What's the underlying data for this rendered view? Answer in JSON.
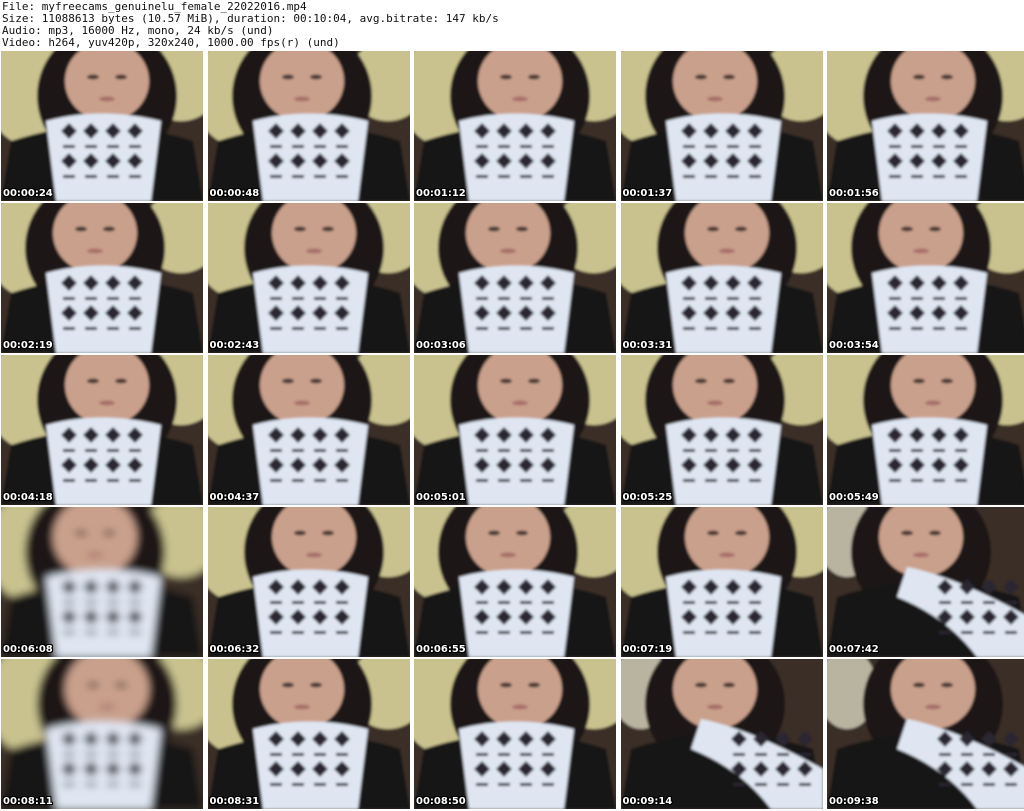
{
  "header": {
    "file": "File: myfreecams_genuinelu_female_22022016.mp4",
    "size": "Size: 11088613 bytes (10.57 MiB), duration: 00:10:04, avg.bitrate: 147 kb/s",
    "audio": "Audio: mp3, 16000 Hz, mono, 24 kb/s (und)",
    "video": "Video: h264, yuv420p, 320x240, 1000.00 fps(r) (und)"
  },
  "thumbnails": [
    {
      "timestamp": "00:00:24",
      "scene": "pillow"
    },
    {
      "timestamp": "00:00:48",
      "scene": "pillow"
    },
    {
      "timestamp": "00:01:12",
      "scene": "pillow"
    },
    {
      "timestamp": "00:01:37",
      "scene": "pillow"
    },
    {
      "timestamp": "00:01:56",
      "scene": "pillow"
    },
    {
      "timestamp": "00:02:19",
      "scene": "pillow"
    },
    {
      "timestamp": "00:02:43",
      "scene": "pillow"
    },
    {
      "timestamp": "00:03:06",
      "scene": "pillow"
    },
    {
      "timestamp": "00:03:31",
      "scene": "pillow"
    },
    {
      "timestamp": "00:03:54",
      "scene": "pillow"
    },
    {
      "timestamp": "00:04:18",
      "scene": "pillow"
    },
    {
      "timestamp": "00:04:37",
      "scene": "pillow"
    },
    {
      "timestamp": "00:05:01",
      "scene": "pillow"
    },
    {
      "timestamp": "00:05:25",
      "scene": "pillow"
    },
    {
      "timestamp": "00:05:49",
      "scene": "pillow"
    },
    {
      "timestamp": "00:06:08",
      "scene": "blurry"
    },
    {
      "timestamp": "00:06:32",
      "scene": "pillow"
    },
    {
      "timestamp": "00:06:55",
      "scene": "pillow"
    },
    {
      "timestamp": "00:07:19",
      "scene": "pillow"
    },
    {
      "timestamp": "00:07:42",
      "scene": "dark"
    },
    {
      "timestamp": "00:08:11",
      "scene": "blurry"
    },
    {
      "timestamp": "00:08:31",
      "scene": "pillow"
    },
    {
      "timestamp": "00:08:50",
      "scene": "pillow"
    },
    {
      "timestamp": "00:09:14",
      "scene": "dark"
    },
    {
      "timestamp": "00:09:38",
      "scene": "dark"
    }
  ],
  "colors": {
    "pillow": "#c9c28f",
    "background": "#3b2f27",
    "hair": "#1b1512",
    "skin": "#c9a08c",
    "scarf_light": "#dfe6f2",
    "scarf_dark": "#2a2630",
    "shirt": "#141214",
    "timestamp_text": "#ffffff"
  }
}
